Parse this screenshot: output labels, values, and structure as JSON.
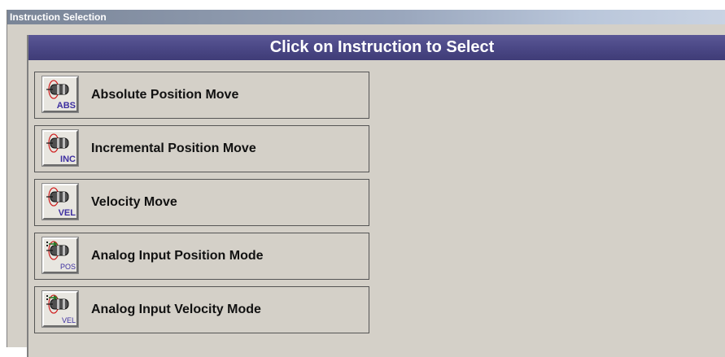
{
  "window": {
    "title": "Instruction Selection"
  },
  "panel": {
    "header": "Click on Instruction to Select"
  },
  "instructions": [
    {
      "label": "Absolute Position Move",
      "icon": "motor-abs-icon",
      "tag": "ABS",
      "analog": false
    },
    {
      "label": "Incremental Position Move",
      "icon": "motor-inc-icon",
      "tag": "INC",
      "analog": false
    },
    {
      "label": "Velocity Move",
      "icon": "motor-vel-icon",
      "tag": "VEL",
      "analog": false
    },
    {
      "label": "Analog Input Position Mode",
      "icon": "motor-analog-pos-icon",
      "tag": "POS",
      "analog": true
    },
    {
      "label": "Analog Input Velocity Mode",
      "icon": "motor-analog-vel-icon",
      "tag": "VEL",
      "analog": true
    }
  ],
  "colors": {
    "header_bg": "#4a4785",
    "panel_bg": "#d4d0c8",
    "tag_text": "#3d2fa0",
    "motor_ring": "#d02020"
  }
}
